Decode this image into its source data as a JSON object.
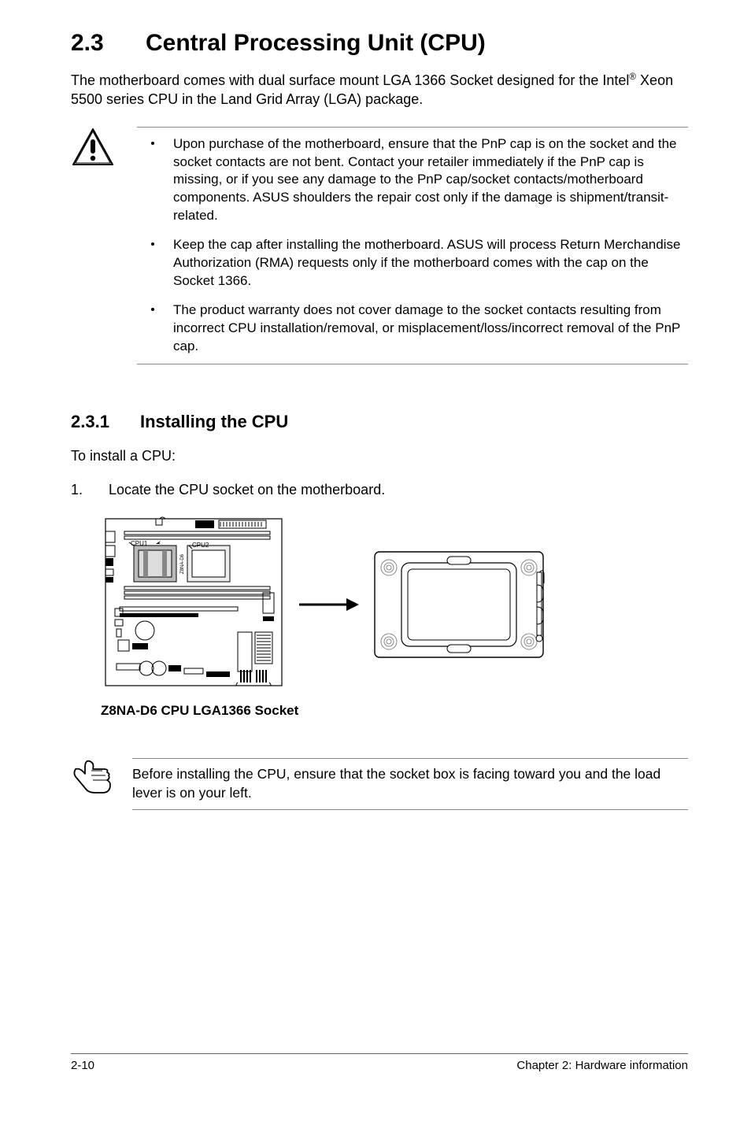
{
  "section": {
    "number": "2.3",
    "title": "Central Processing Unit (CPU)",
    "intro_pre": "The motherboard comes with dual surface mount LGA 1366 Socket designed for the Intel",
    "intro_sup": "®",
    "intro_post": " Xeon 5500 series CPU in the Land Grid Array (LGA) package."
  },
  "warnings": [
    "Upon purchase of the motherboard, ensure that the PnP cap is on the socket and the socket contacts are not bent. Contact your retailer immediately if the PnP cap is missing, or if you see any damage to the PnP cap/socket contacts/motherboard components. ASUS shoulders the repair cost only if the damage is shipment/transit-related.",
    "Keep the cap after installing the motherboard. ASUS will process Return Merchandise Authorization (RMA) requests only if the motherboard comes with the cap on the Socket 1366.",
    "The product warranty does not cover damage to the socket contacts resulting from incorrect CPU installation/removal, or misplacement/loss/incorrect removal of the PnP cap."
  ],
  "subsection": {
    "number": "2.3.1",
    "title": "Installing the CPU",
    "lead": "To install a CPU:",
    "step1_n": "1.",
    "step1": "Locate the CPU socket on the motherboard.",
    "caption": "Z8NA-D6 CPU LGA1366 Socket",
    "labels": {
      "cpu1": "CPU1",
      "cpu2": "CPU2",
      "board": "Z8NA-D6"
    }
  },
  "tip": "Before installing the CPU, ensure that the socket box is facing toward you and the load lever is on your left.",
  "footer": {
    "left": "2-10",
    "right": "Chapter 2: Hardware information"
  },
  "icons": {
    "warning": "warning-triangle",
    "tip": "hand-pointer"
  }
}
